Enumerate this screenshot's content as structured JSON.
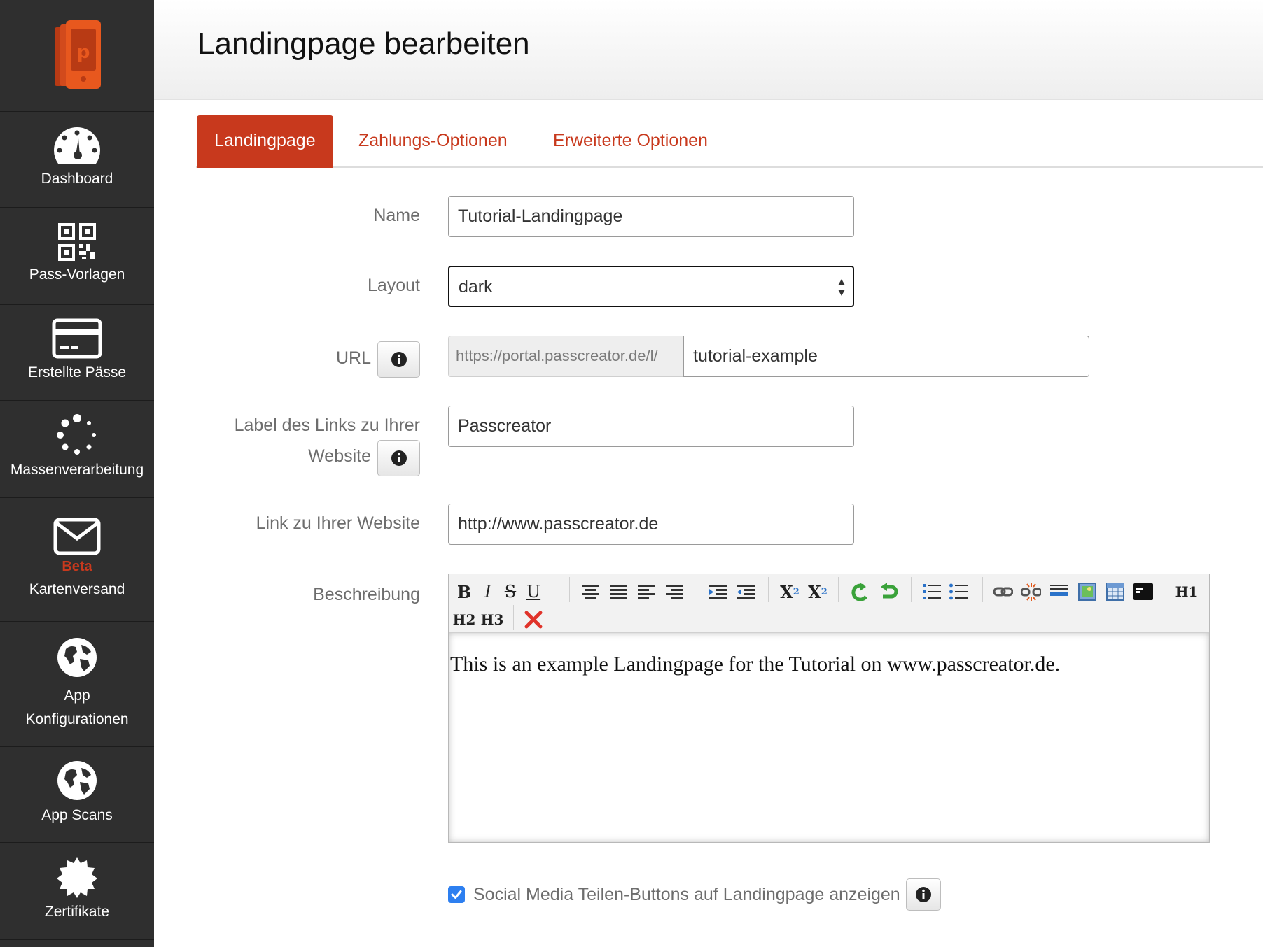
{
  "header": {
    "title": "Landingpage bearbeiten"
  },
  "sidebar": {
    "logo_icon": "passcreator-logo-icon",
    "items": [
      {
        "label": "Dashboard",
        "icon": "dashboard-icon"
      },
      {
        "label": "Pass-Vorlagen",
        "icon": "qr-code-icon"
      },
      {
        "label": "Erstellte Pässe",
        "icon": "card-icon"
      },
      {
        "label": "Massenverarbeitung",
        "icon": "spinner-icon"
      },
      {
        "badge": "Beta",
        "label": "Kartenversand",
        "icon": "envelope-icon"
      },
      {
        "label": "App",
        "label2": "Konfigurationen",
        "icon": "globe-icon"
      },
      {
        "label": "App Scans",
        "icon": "globe-icon"
      },
      {
        "label": "Zertifikate",
        "icon": "certificate-icon"
      }
    ]
  },
  "tabs": [
    {
      "label": "Landingpage",
      "active": true
    },
    {
      "label": "Zahlungs-Optionen",
      "active": false
    },
    {
      "label": "Erweiterte Optionen",
      "active": false
    }
  ],
  "form": {
    "name_label": "Name",
    "name_value": "Tutorial-Landingpage",
    "layout_label": "Layout",
    "layout_value": "dark",
    "url_label": "URL",
    "url_prefix": "https://portal.passcreator.de/l/",
    "url_value": "tutorial-example",
    "link_label_line1": "Label des Links zu Ihrer",
    "link_label_line2": "Website",
    "link_label_value": "Passcreator",
    "website_label": "Link zu Ihrer Website",
    "website_value": "http://www.passcreator.de",
    "description_label": "Beschreibung",
    "description_text": "This is an example Landingpage for the Tutorial on www.passcreator.de.",
    "social_label": "Social Media Teilen-Buttons auf Landingpage anzeigen",
    "social_checked": true
  },
  "toolbar": {
    "bold": "B",
    "italic": "I",
    "strike": "S",
    "underline": "U",
    "subscript": "X",
    "superscript": "X",
    "h1": "H1",
    "h2": "H2",
    "h3": "H3"
  },
  "colors": {
    "accent": "#c8391d",
    "sidebar_bg": "#2f2f2f",
    "checkbox": "#2d7ff0"
  }
}
